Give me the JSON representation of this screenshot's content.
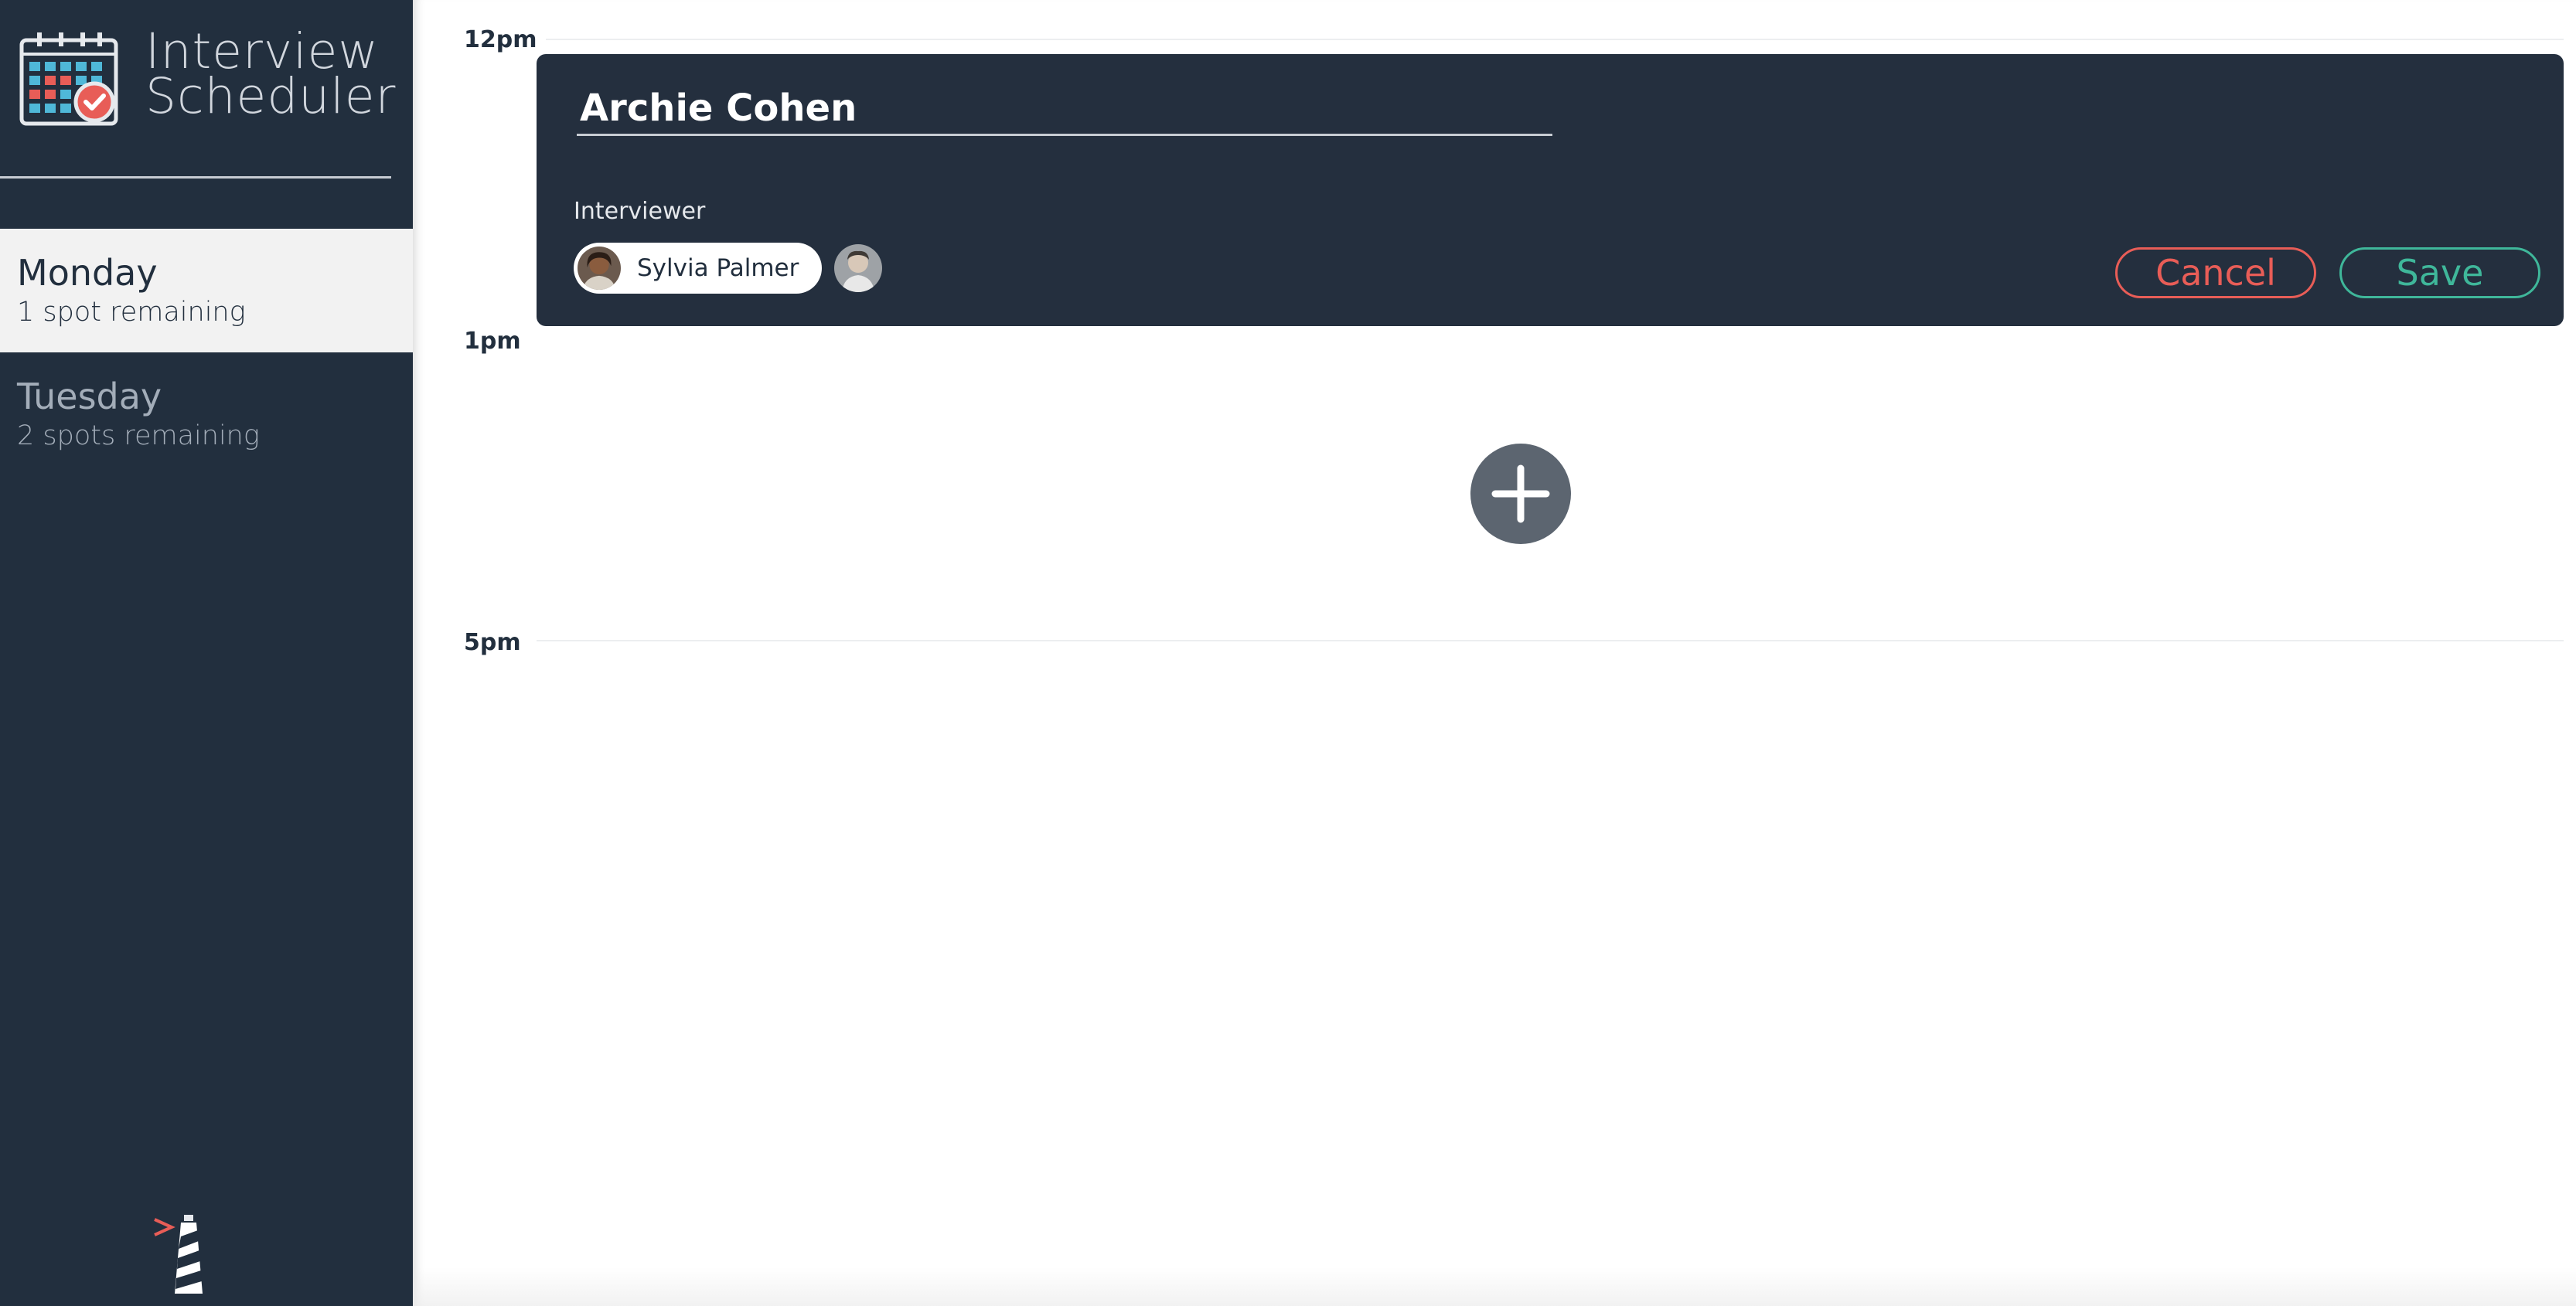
{
  "app": {
    "title_line1": "Interview",
    "title_line2": "Scheduler"
  },
  "sidebar": {
    "days": [
      {
        "name": "Monday",
        "spots": "1 spot remaining",
        "selected": true
      },
      {
        "name": "Tuesday",
        "spots": "2 spots remaining",
        "selected": false
      }
    ]
  },
  "schedule": {
    "times": [
      "12pm",
      "1pm",
      "5pm"
    ]
  },
  "appointment_form": {
    "student_name": "Archie Cohen",
    "interviewer_heading": "Interviewer",
    "selected_interviewer": "Sylvia Palmer",
    "cancel_label": "Cancel",
    "save_label": "Save"
  },
  "colors": {
    "sidebar_bg": "#222f3e",
    "selected_day_bg": "#f2f2f2",
    "cancel": "#e85d57",
    "save": "#3fb79a",
    "add_button": "#5c6570"
  },
  "icons": {
    "logo": "calendar-check-icon",
    "add": "plus-icon",
    "footer": "lighthouse-icon"
  }
}
